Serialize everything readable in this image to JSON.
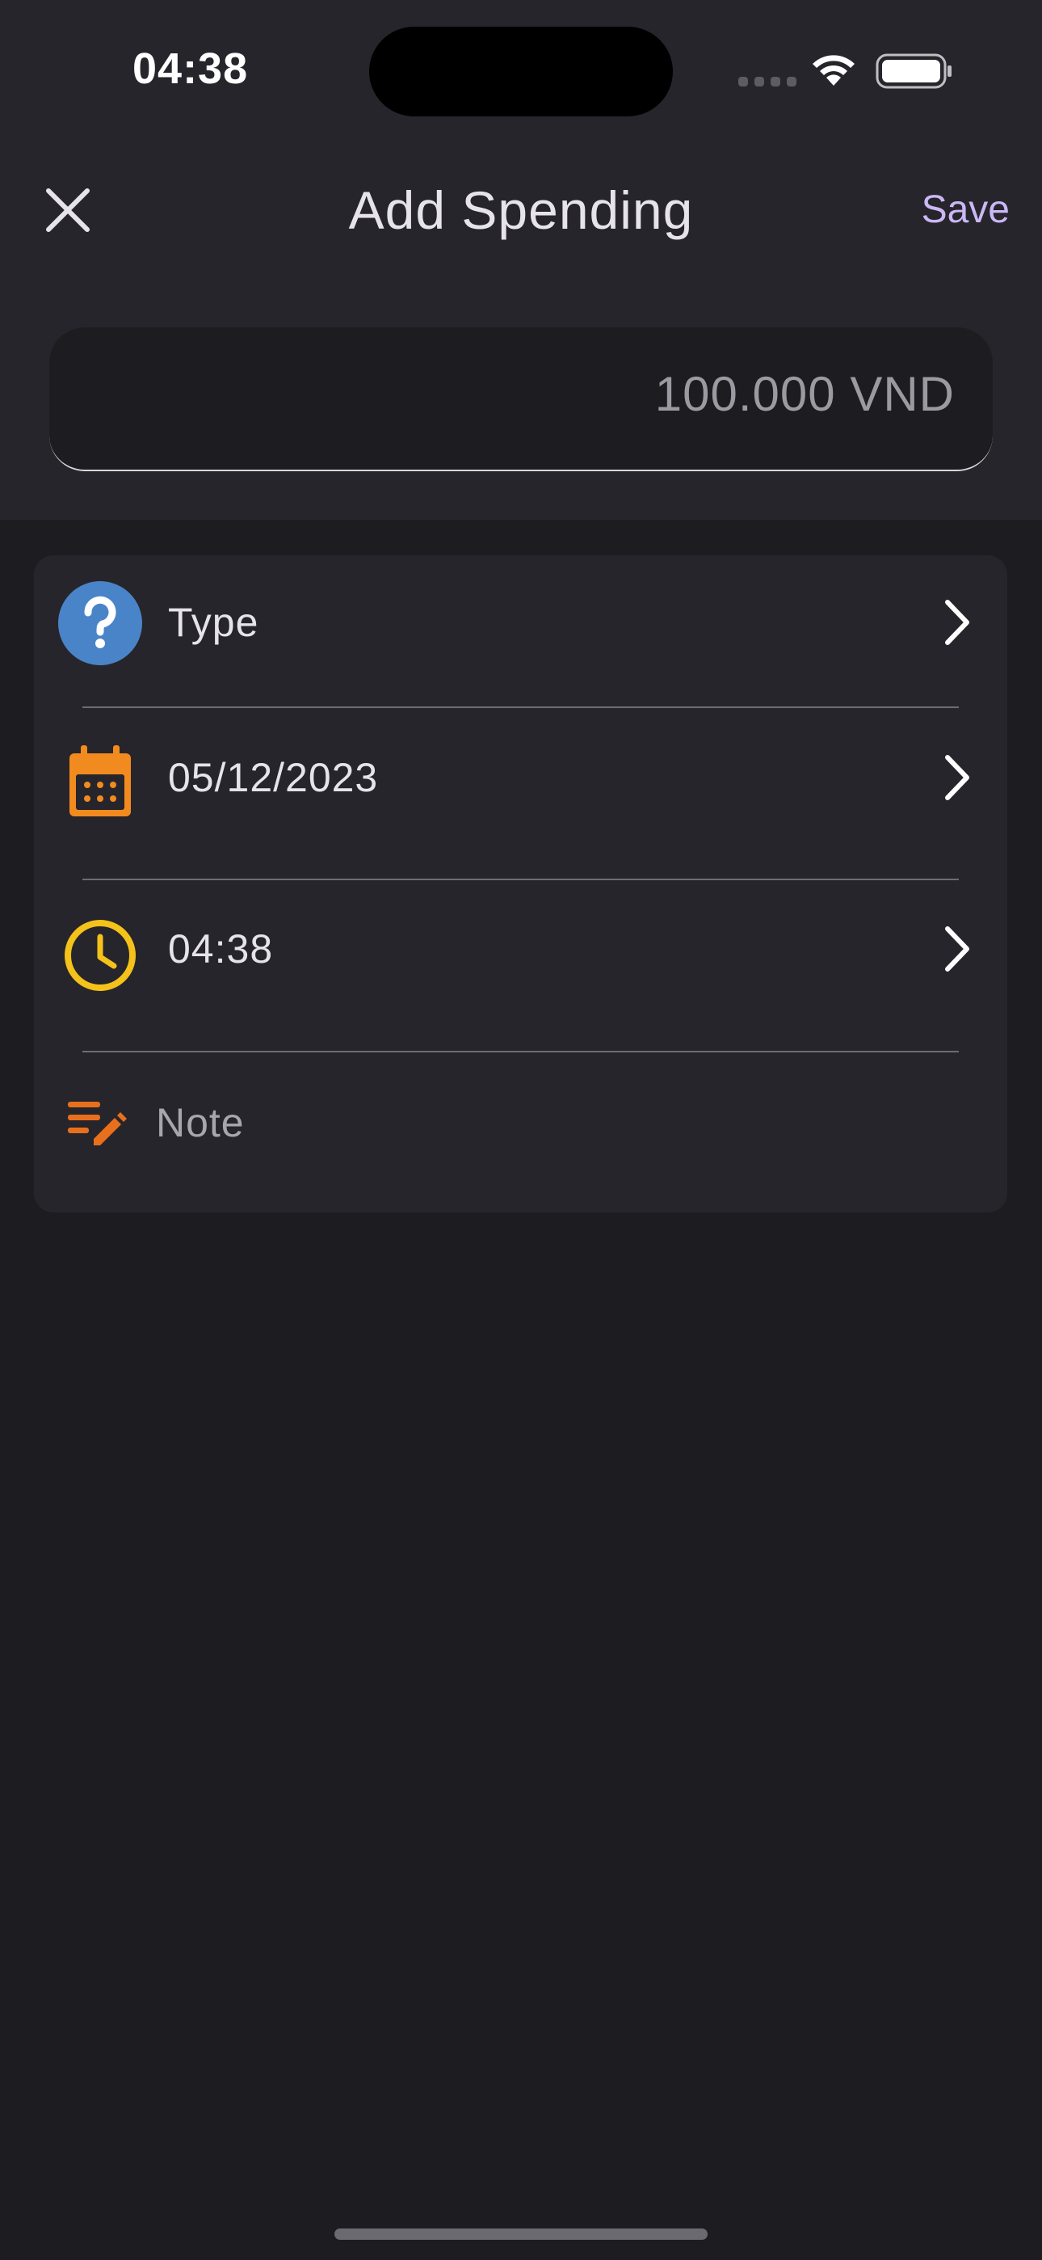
{
  "status_bar": {
    "time": "04:38"
  },
  "header": {
    "title": "Add Spending",
    "save_label": "Save"
  },
  "amount": {
    "value": "100.000 VND"
  },
  "form": {
    "type_label": "Type",
    "date_value": "05/12/2023",
    "time_value": "04:38",
    "note_placeholder": "Note"
  },
  "colors": {
    "accent": "#cbb7f5",
    "type_icon": "#4a84c8",
    "date_icon": "#f28b1f",
    "time_icon": "#f4c21a",
    "note_icon": "#e8701c"
  },
  "icons": {
    "close": "close-icon",
    "type": "question-icon",
    "date": "calendar-icon",
    "time": "clock-icon",
    "note": "edit-note-icon",
    "chevron": "chevron-right-icon"
  }
}
